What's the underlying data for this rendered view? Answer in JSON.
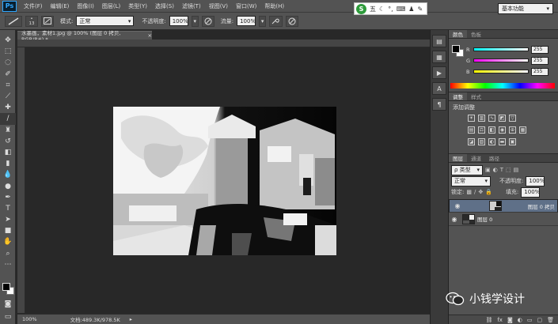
{
  "app": {
    "logo": "Ps"
  },
  "menu": [
    "文件(F)",
    "编辑(E)",
    "图像(I)",
    "图层(L)",
    "类型(Y)",
    "选择(S)",
    "滤镜(T)",
    "视图(V)",
    "窗口(W)",
    "帮助(H)"
  ],
  "window_controls": [
    "—",
    "☐",
    "✕"
  ],
  "options": {
    "brush_size": "13",
    "mode_label": "模式:",
    "mode_value": "正常",
    "opacity_label": "不透明度:",
    "opacity_value": "100%",
    "flow_label": "流量:",
    "flow_value": "100%",
    "workspace": "基本功能"
  },
  "ime": {
    "letter": "S",
    "text": "五"
  },
  "document": {
    "tab_title": "水墨画，素材1.jpg @ 100% (图层 0 拷贝, RGB/8#) *",
    "zoom": "100%",
    "doc_info": "文档:489.3K/978.5K"
  },
  "color_panel": {
    "tabs": [
      "颜色",
      "色板"
    ],
    "channels": [
      {
        "label": "R",
        "value": "255"
      },
      {
        "label": "G",
        "value": "255"
      },
      {
        "label": "B",
        "value": "255"
      }
    ]
  },
  "adjustments_panel": {
    "tabs": [
      "调整",
      "样式"
    ],
    "title": "添加调整"
  },
  "layers_panel": {
    "tabs": [
      "图层",
      "通道",
      "路径"
    ],
    "filter_kind": "ρ 类型",
    "blend_mode": "正常",
    "opacity_label": "不透明度:",
    "opacity_value": "100%",
    "lock_label": "锁定:",
    "fill_label": "填充:",
    "fill_value": "100%",
    "layers": [
      {
        "name": "图层 0 拷贝",
        "selected": true,
        "visible": true
      },
      {
        "name": "图层 0",
        "selected": false,
        "visible": true
      }
    ]
  },
  "watermark": {
    "text": "小钱学设计"
  },
  "colors": {
    "accent": "#31a8ff",
    "panel": "#535353",
    "canvas_bg": "#282828",
    "selected_layer": "#5f7088"
  }
}
